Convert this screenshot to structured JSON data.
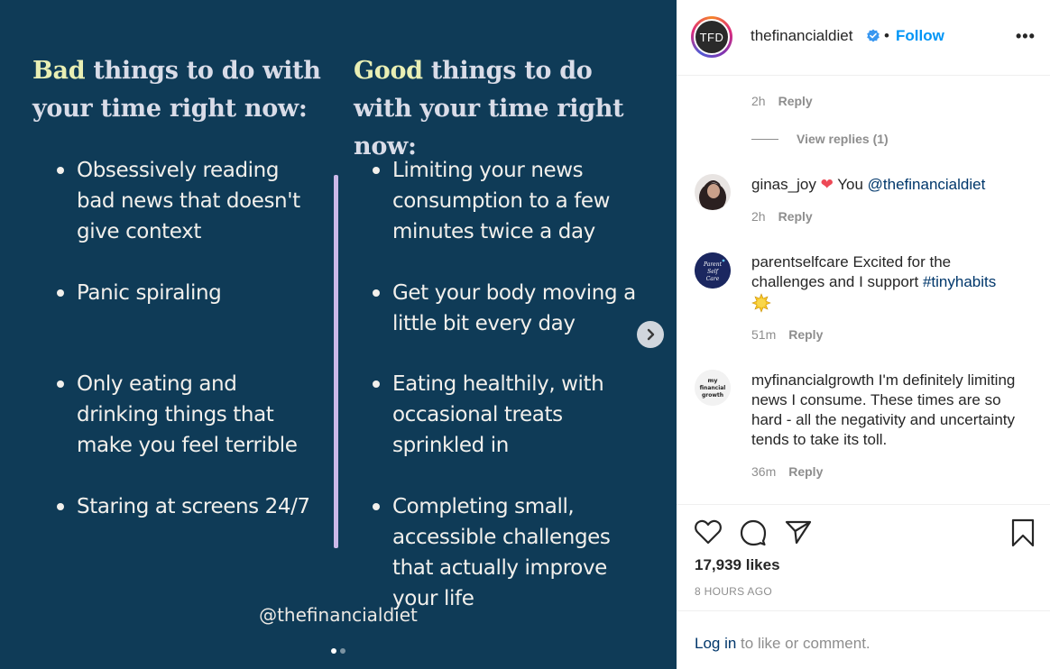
{
  "post": {
    "left_heading": {
      "accent": "Bad",
      "rest": " things to do with your time right now:"
    },
    "right_heading": {
      "accent": "Good",
      "rest": " things to do with your time right now:"
    },
    "bad_items": [
      "Obsessively reading bad news that doesn't give context",
      "Panic spiraling",
      "Only eating and drinking things that make you feel terrible",
      "Staring at screens 24/7"
    ],
    "good_items": [
      "Limiting your news consumption to a few minutes twice a day",
      "Get your body moving a little bit every day",
      "Eating healthily, with occasional treats sprinkled in",
      "Completing small, accessible challenges that actually improve your life"
    ],
    "watermark": "@thefinancialdiet",
    "carousel": {
      "total": 2,
      "active": 1
    },
    "colors": {
      "background": "#0f3b57",
      "divider": "#cbb9e8",
      "accent": "#e9efb4"
    }
  },
  "header": {
    "avatar_text": "TFD",
    "username": "thefinancialdiet",
    "separator": "•",
    "follow_label": "Follow",
    "more_label": "•••"
  },
  "comments": {
    "first_meta": {
      "time": "2h",
      "reply": "Reply"
    },
    "view_replies": "View replies (1)",
    "items": [
      {
        "user": "ginas_joy",
        "text": " You ",
        "mention": "@thefinancialdiet",
        "emoji": "heart",
        "time": "2h",
        "reply": "Reply"
      },
      {
        "user": "parentselfcare",
        "text": " Excited for the challenges and I support ",
        "mention": "#tinyhabits",
        "emoji": "sun",
        "time": "51m",
        "reply": "Reply",
        "avatar_text": "Parent Self Care"
      },
      {
        "user": "myfinancialgrowth",
        "text": " I'm definitely limiting news I consume. These times are so hard - all the negativity and uncertainty tends to take its toll.",
        "time": "36m",
        "reply": "Reply",
        "avatar_text": "my financial growth"
      }
    ]
  },
  "actions": {
    "icons": [
      "heart-icon",
      "comment-icon",
      "share-icon",
      "bookmark-icon"
    ],
    "likes": "17,939 likes",
    "time_ago": "8 HOURS AGO"
  },
  "login": {
    "link": "Log in",
    "rest": " to like or comment."
  }
}
